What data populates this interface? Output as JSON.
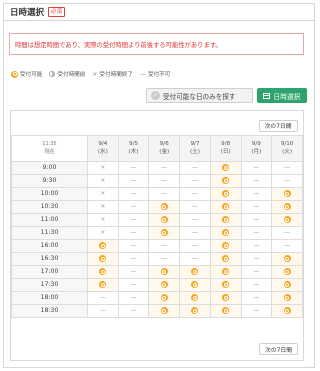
{
  "header": {
    "title": "日時選択",
    "required": "必須"
  },
  "notice": "時間は想定時間であり、実際の受付時間より前後する可能性があります。",
  "legend": {
    "available": "受付可能",
    "pre_open": "受付時間前",
    "closed": "受付時間終了",
    "unavailable": "受付不可"
  },
  "buttons": {
    "search_available": "受付可能な日のみを探す",
    "select_datetime": "日時選択",
    "next_week": "次の7日間"
  },
  "calendar": {
    "corner": {
      "time": "11:35",
      "label": "現在"
    },
    "days": [
      {
        "date": "9/4",
        "dow": "(水)"
      },
      {
        "date": "9/5",
        "dow": "(木)"
      },
      {
        "date": "9/6",
        "dow": "(金)"
      },
      {
        "date": "9/7",
        "dow": "(土)"
      },
      {
        "date": "9/8",
        "dow": "(日)"
      },
      {
        "date": "9/9",
        "dow": "(月)"
      },
      {
        "date": "9/10",
        "dow": "(火)"
      }
    ],
    "rows": [
      {
        "time": "9:00",
        "slots": [
          "×",
          "—",
          "—",
          "—",
          "○",
          "—",
          "—"
        ]
      },
      {
        "time": "9:30",
        "slots": [
          "×",
          "—",
          "—",
          "—",
          "○",
          "—",
          "—"
        ]
      },
      {
        "time": "10:00",
        "slots": [
          "×",
          "—",
          "—",
          "—",
          "○",
          "—",
          "○"
        ]
      },
      {
        "time": "10:30",
        "slots": [
          "×",
          "—",
          "○",
          "—",
          "○",
          "—",
          "○"
        ]
      },
      {
        "time": "11:00",
        "slots": [
          "×",
          "—",
          "○",
          "—",
          "○",
          "—",
          "○"
        ]
      },
      {
        "time": "11:30",
        "slots": [
          "×",
          "—",
          "○",
          "—",
          "○",
          "—",
          "—"
        ]
      },
      {
        "time": "16:00",
        "slots": [
          "○",
          "—",
          "—",
          "—",
          "○",
          "—",
          "—"
        ]
      },
      {
        "time": "16:30",
        "slots": [
          "○",
          "—",
          "—",
          "—",
          "○",
          "—",
          "○"
        ]
      },
      {
        "time": "17:00",
        "slots": [
          "○",
          "—",
          "○",
          "○",
          "○",
          "—",
          "○"
        ]
      },
      {
        "time": "17:30",
        "slots": [
          "○",
          "—",
          "○",
          "○",
          "○",
          "—",
          "○"
        ]
      },
      {
        "time": "18:00",
        "slots": [
          "—",
          "—",
          "○",
          "○",
          "○",
          "—",
          "○"
        ]
      },
      {
        "time": "18:30",
        "slots": [
          "—",
          "—",
          "○",
          "○",
          "○",
          "—",
          "○"
        ]
      }
    ]
  }
}
